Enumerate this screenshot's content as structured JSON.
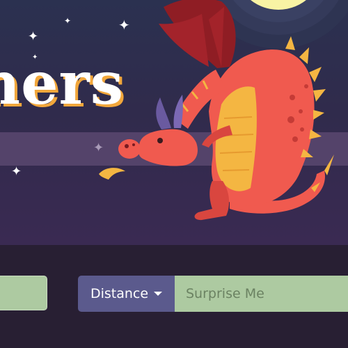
{
  "hero": {
    "title": "ners"
  },
  "search": {
    "distance_label": "Distance",
    "placeholder": "Surprise Me",
    "left_value": ""
  },
  "colors": {
    "sky_top": "#2b3150",
    "sky_bottom": "#3a2a52",
    "band": "#5a4870",
    "moon": "#f8f3a4",
    "dragon_body": "#f05a4f",
    "dragon_belly": "#f4b642",
    "dragon_wing": "#8f1d24",
    "title_shadow": "#f2a73b",
    "control_bg": "#281f33",
    "input_green": "#adcaa1",
    "button_purple": "#5b5a8d"
  },
  "icons": {
    "sparkle": "sparkle-icon",
    "dropdown": "caret-down-icon"
  }
}
